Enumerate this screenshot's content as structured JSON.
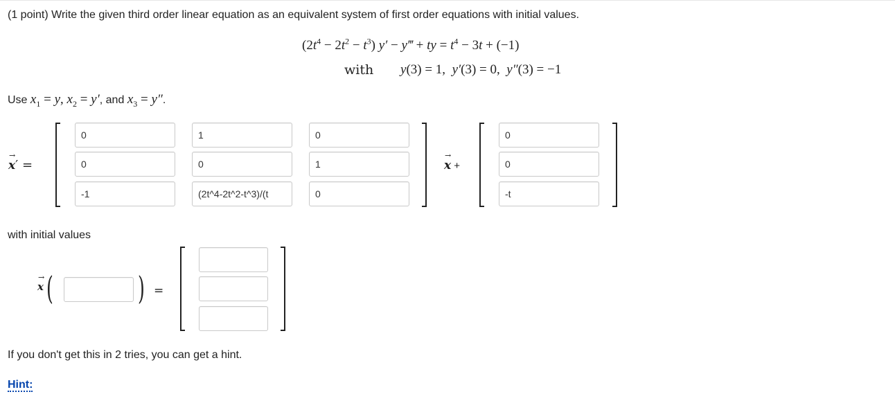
{
  "problem": {
    "intro": "(1 point) Write the given third order linear equation as an equivalent system of first order equations with initial values.",
    "with_label": "with",
    "use_label": "Use",
    "and_label": "and",
    "initial_values_label": "with initial values",
    "hint_text": "If you don't get this in 2 tries, you can get a hint.",
    "hint_link": "Hint:"
  },
  "matrix_A": [
    [
      "0",
      "1",
      "0"
    ],
    [
      "0",
      "0",
      "1"
    ],
    [
      "-1",
      "(2t^4-2t^2-t^3)/(t",
      "0"
    ]
  ],
  "vector_b": [
    "0",
    "0",
    "-t"
  ],
  "initial": {
    "t0": "",
    "values": [
      "",
      "",
      ""
    ]
  },
  "symbols": {
    "x_prime": "x⃗′ =",
    "x_plus": "x⃗ +",
    "equals": "="
  }
}
